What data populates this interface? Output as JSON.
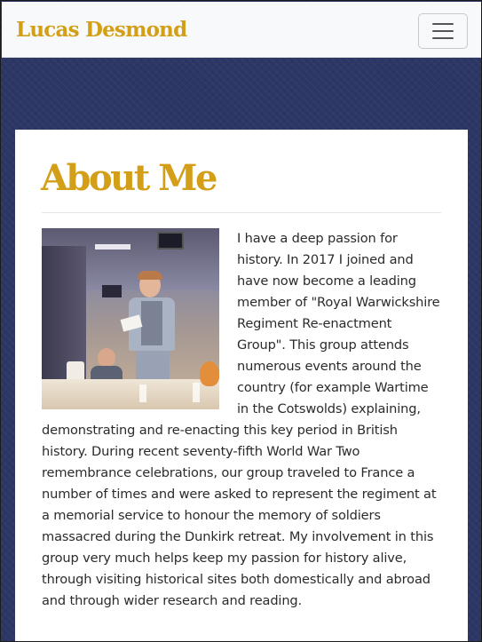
{
  "navbar": {
    "brand": "Lucas Desmond",
    "toggle_icon": "hamburger-menu-icon"
  },
  "about": {
    "title": "About Me",
    "photo_icon": "profile-photo",
    "body": "I have a deep passion for history. In 2017 I joined and have now become a leading member of \"Royal Warwickshire Regiment Re-enactment Group\". This group attends numerous events around the country (for example Wartime in the Cotswolds) explaining, demonstrating and re-enacting this key period in British history. During recent seventy-fifth World War Two remembrance celebrations, our group traveled to France a number of times and were asked to represent the regiment at a memorial service to honour the memory of soldiers massacred during the Dunkirk retreat. My involvement in this group very much helps keep my passion for history alive, through visiting historical sites both domestically and abroad and through wider research and reading."
  },
  "colors": {
    "accent": "#d39e18",
    "background": "#2c3766",
    "card": "#ffffff",
    "navbar": "#f8f9fa",
    "text": "#2b2b2b"
  }
}
